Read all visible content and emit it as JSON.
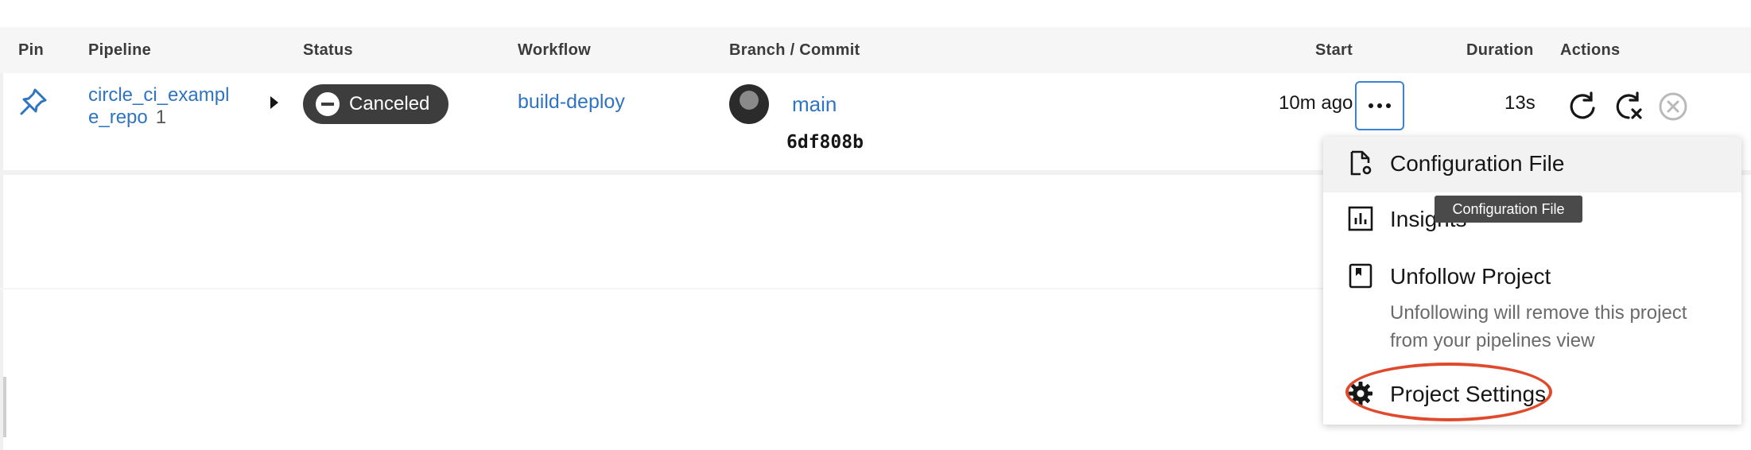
{
  "table": {
    "headers": {
      "pin": "Pin",
      "pipeline": "Pipeline",
      "status": "Status",
      "workflow": "Workflow",
      "branch_commit": "Branch / Commit",
      "start": "Start",
      "duration": "Duration",
      "actions": "Actions"
    },
    "row": {
      "pipeline_name": "circle_ci_exampl e_repo",
      "pipeline_number": "1",
      "status": "Canceled",
      "workflow": "build-deploy",
      "branch": "main",
      "commit": "6df808b",
      "start": "10m ago",
      "duration": "13s"
    }
  },
  "actions": {
    "icons": [
      "rerun-icon",
      "rerun-failed-icon",
      "cancel-icon",
      "more-icon"
    ]
  },
  "menu": {
    "items": [
      {
        "label": "Configuration File",
        "icon": "config-file-icon"
      },
      {
        "label": "Insights",
        "icon": "insights-icon"
      },
      {
        "label": "Unfollow Project",
        "icon": "bookmark-icon",
        "description": "Unfollowing will remove this project from your pipelines view"
      },
      {
        "label": "Project Settings",
        "icon": "gear-icon"
      }
    ]
  },
  "tooltip": {
    "text": "Configuration File"
  },
  "colors": {
    "link": "#2f74c0",
    "badge": "#3d3d3d",
    "focus_border": "#3b82d0",
    "highlight": "#e04a2c"
  }
}
